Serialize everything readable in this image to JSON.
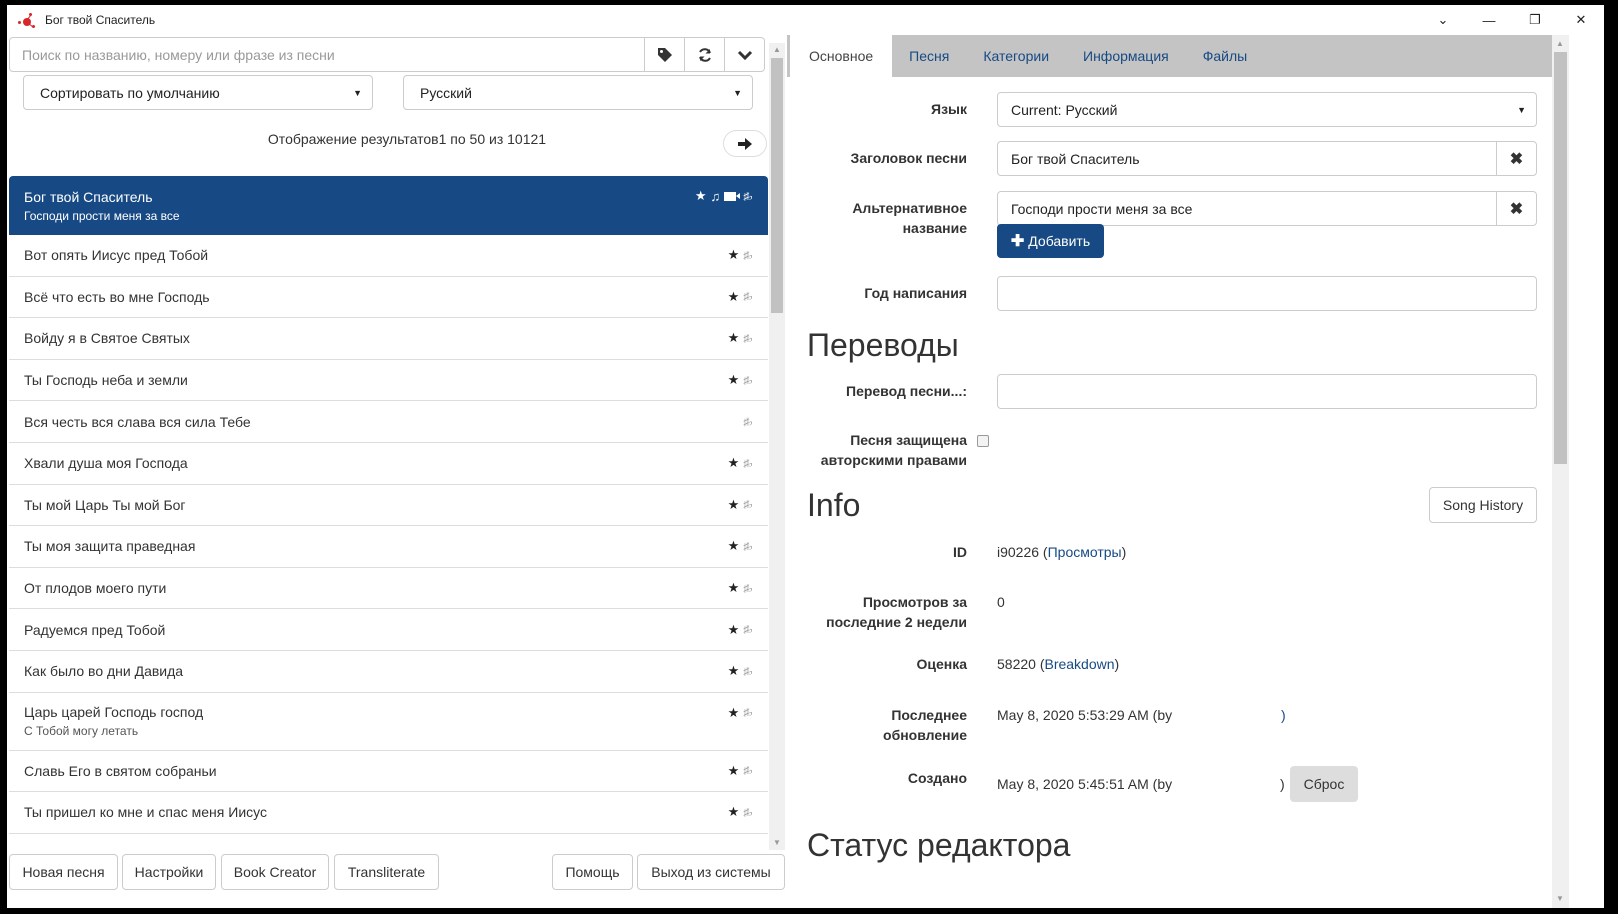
{
  "window": {
    "title": "Бог твой Спаситель",
    "controls": {
      "collapse": "⌄",
      "minimize": "—",
      "restore": "❐",
      "close": "✕"
    }
  },
  "left": {
    "search": {
      "placeholder": "Поиск по названию, номеру или фразе из песни",
      "value": ""
    },
    "search_icons": [
      "tag-icon",
      "refresh-icon",
      "chevron-down-icon"
    ],
    "search_glyphs": {
      "tag": "🏷",
      "refresh": "⟳",
      "chevron": "⌄"
    },
    "sort_select": {
      "value": "Сортировать по умолчанию"
    },
    "language_select": {
      "value": "Русский"
    },
    "results_info": "Отображение результатов1 по 50 из 10121",
    "next_glyph": "➡",
    "songs": [
      {
        "title": "Бог твой Спаситель",
        "subtitle": "Господи прости меня за все",
        "star": true,
        "music": true,
        "video": true,
        "keys": true,
        "selected": true
      },
      {
        "title": "Вот опять Иисус пред Тобой",
        "star": true,
        "keys": true
      },
      {
        "title": "Всё что есть во мне Господь",
        "star": true,
        "keys": true
      },
      {
        "title": "Войду я в Святое Святых",
        "star": true,
        "keys": true
      },
      {
        "title": "Ты Господь неба и земли",
        "star": true,
        "keys": true
      },
      {
        "title": "Вся честь вся слава вся сила Тебе",
        "star": false,
        "keys": true
      },
      {
        "title": "Хвали душа моя Господа",
        "star": true,
        "keys": true
      },
      {
        "title": "Ты мой Царь Ты мой Бог",
        "star": true,
        "keys": true
      },
      {
        "title": "Ты моя защита праведная",
        "star": true,
        "keys": true
      },
      {
        "title": "От плодов моего пути",
        "star": true,
        "keys": true
      },
      {
        "title": "Радуемся пред Тобой",
        "star": true,
        "keys": true
      },
      {
        "title": "Как было во дни Давида",
        "star": true,
        "keys": true
      },
      {
        "title": "Царь царей Господь господ",
        "subtitle": "С Тобой могу летать",
        "star": true,
        "keys": true
      },
      {
        "title": "Славь Его в святом собраньи",
        "star": true,
        "keys": true
      },
      {
        "title": "Ты пришел ко мне и спас меня Иисус",
        "star": true,
        "keys": true
      }
    ],
    "glyphs": {
      "star": "★",
      "music": "♫",
      "keys": "♯♭"
    },
    "bottom_buttons": {
      "new_song": "Новая песня",
      "settings": "Настройки",
      "book_creator": "Book Creator",
      "transliterate": "Transliterate",
      "help": "Помощь",
      "logout": "Выход из системы"
    }
  },
  "right": {
    "tabs": [
      {
        "label": "Основное",
        "active": true
      },
      {
        "label": "Песня"
      },
      {
        "label": "Категории"
      },
      {
        "label": "Информация"
      },
      {
        "label": "Файлы"
      }
    ],
    "form": {
      "language_label": "Язык",
      "language_value": "Current: Русский",
      "title_label": "Заголовок песни",
      "title_value": "Бог твой Спаситель",
      "alt_label_1": "Альтернативное",
      "alt_label_2": "название",
      "alt_value": "Господи прости меня за все",
      "add_button": "Добавить",
      "year_label": "Год написания",
      "year_value": "",
      "clear_glyph": "✖"
    },
    "translations": {
      "heading": "Переводы",
      "translation_label": "Перевод песни...:",
      "translation_value": "",
      "copyright_label_1": "Песня защищена",
      "copyright_label_2": "авторскими правами",
      "copyright_checked": false
    },
    "info": {
      "heading": "Info",
      "song_history_button": "Song History",
      "id_label": "ID",
      "id_value": "i90226 (",
      "id_link": "Просмотры",
      "id_close": ")",
      "views_label_1": "Просмотров за",
      "views_label_2": "последние 2 недели",
      "views_value": "0",
      "rating_label": "Оценка",
      "rating_value": "58220 (",
      "rating_link": "Breakdown",
      "rating_close": ")",
      "updated_label_1": "Последнее",
      "updated_label_2": "обновление",
      "updated_value": "May 8, 2020 5:53:29 AM (by",
      "updated_close": ")",
      "created_label": "Создано",
      "created_value": "May 8, 2020 5:45:51 AM (by",
      "created_close": ")",
      "reset_button": "Сброс"
    },
    "editor_status": {
      "heading": "Статус редактора"
    }
  }
}
